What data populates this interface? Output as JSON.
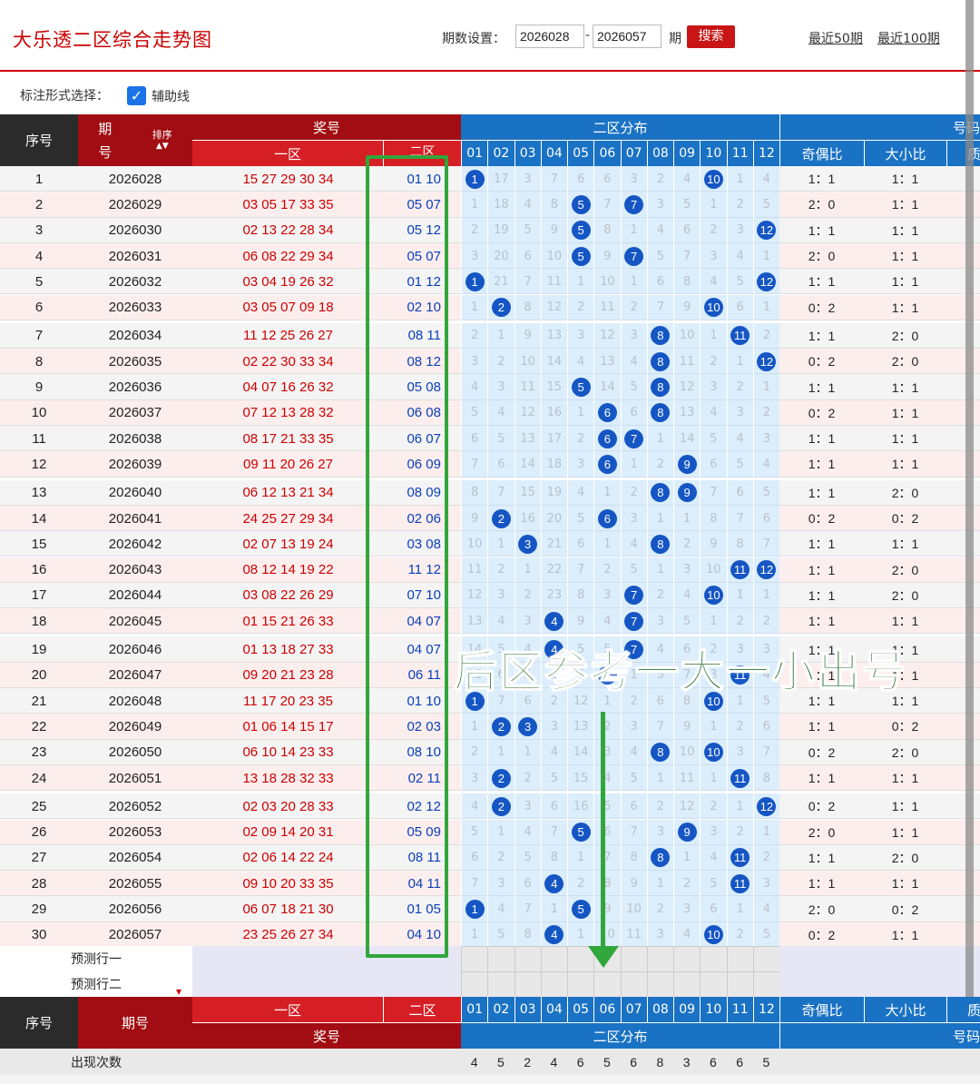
{
  "header": {
    "title": "大乐透二区综合走势图",
    "period_label": "期数设置：",
    "from": "2026028",
    "to": "2026057",
    "dash": "-",
    "qi": "期",
    "search": "搜索",
    "recent50": "最近50期",
    "recent100": "最近100期"
  },
  "options": {
    "label": "标注形式选择：",
    "checkbox_label": "辅助线"
  },
  "table": {
    "h_seq": "序号",
    "h_issue1": "期",
    "h_issue2": "号",
    "h_sort": "排序",
    "h_award": "奖号",
    "h_zone1": "一区",
    "h_zone2": "二区",
    "h_dist": "二区分布",
    "h_hao": "号码",
    "h_odd": "奇偶比",
    "h_big": "大小比",
    "h_prime": "质",
    "cols": [
      "01",
      "02",
      "03",
      "04",
      "05",
      "06",
      "07",
      "08",
      "09",
      "10",
      "11",
      "12"
    ],
    "rows": [
      {
        "n": "1",
        "issue": "2026028",
        "front": "15 27 29 30 34",
        "back": "01 10",
        "dist": [
          "1",
          "17",
          "3",
          "7",
          "6",
          "6",
          "3",
          "2",
          "4",
          "10",
          "1",
          "4"
        ],
        "odd": "1：1",
        "big": "1：1"
      },
      {
        "n": "2",
        "issue": "2026029",
        "front": "03 05 17 33 35",
        "back": "05 07",
        "dist": [
          "1",
          "18",
          "4",
          "8",
          "5",
          "7",
          "7",
          "3",
          "5",
          "1",
          "2",
          "5"
        ],
        "odd": "2：0",
        "big": "1：1"
      },
      {
        "n": "3",
        "issue": "2026030",
        "front": "02 13 22 28 34",
        "back": "05 12",
        "dist": [
          "2",
          "19",
          "5",
          "9",
          "5",
          "8",
          "1",
          "4",
          "6",
          "2",
          "3",
          "12"
        ],
        "odd": "1：1",
        "big": "1：1"
      },
      {
        "n": "4",
        "issue": "2026031",
        "front": "06 08 22 29 34",
        "back": "05 07",
        "dist": [
          "3",
          "20",
          "6",
          "10",
          "5",
          "9",
          "7",
          "5",
          "7",
          "3",
          "4",
          "1"
        ],
        "odd": "2：0",
        "big": "1：1"
      },
      {
        "n": "5",
        "issue": "2026032",
        "front": "03 04 19 26 32",
        "back": "01 12",
        "dist": [
          "1",
          "21",
          "7",
          "11",
          "1",
          "10",
          "1",
          "6",
          "8",
          "4",
          "5",
          "12"
        ],
        "odd": "1：1",
        "big": "1：1"
      },
      {
        "n": "6",
        "issue": "2026033",
        "front": "03 05 07 09 18",
        "back": "02 10",
        "dist": [
          "1",
          "2",
          "8",
          "12",
          "2",
          "11",
          "2",
          "7",
          "9",
          "10",
          "6",
          "1"
        ],
        "odd": "0：2",
        "big": "1：1"
      },
      {
        "n": "7",
        "issue": "2026034",
        "front": "11 12 25 26 27",
        "back": "08 11",
        "dist": [
          "2",
          "1",
          "9",
          "13",
          "3",
          "12",
          "3",
          "8",
          "10",
          "1",
          "11",
          "2"
        ],
        "odd": "1：1",
        "big": "2：0"
      },
      {
        "n": "8",
        "issue": "2026035",
        "front": "02 22 30 33 34",
        "back": "08 12",
        "dist": [
          "3",
          "2",
          "10",
          "14",
          "4",
          "13",
          "4",
          "8",
          "11",
          "2",
          "1",
          "12"
        ],
        "odd": "0：2",
        "big": "2：0"
      },
      {
        "n": "9",
        "issue": "2026036",
        "front": "04 07 16 26 32",
        "back": "05 08",
        "dist": [
          "4",
          "3",
          "11",
          "15",
          "5",
          "14",
          "5",
          "8",
          "12",
          "3",
          "2",
          "1"
        ],
        "odd": "1：1",
        "big": "1：1"
      },
      {
        "n": "10",
        "issue": "2026037",
        "front": "07 12 13 28 32",
        "back": "06 08",
        "dist": [
          "5",
          "4",
          "12",
          "16",
          "1",
          "6",
          "6",
          "8",
          "13",
          "4",
          "3",
          "2"
        ],
        "odd": "0：2",
        "big": "1：1"
      },
      {
        "n": "11",
        "issue": "2026038",
        "front": "08 17 21 33 35",
        "back": "06 07",
        "dist": [
          "6",
          "5",
          "13",
          "17",
          "2",
          "6",
          "7",
          "1",
          "14",
          "5",
          "4",
          "3"
        ],
        "odd": "1：1",
        "big": "1：1"
      },
      {
        "n": "12",
        "issue": "2026039",
        "front": "09 11 20 26 27",
        "back": "06 09",
        "dist": [
          "7",
          "6",
          "14",
          "18",
          "3",
          "6",
          "1",
          "2",
          "9",
          "6",
          "5",
          "4"
        ],
        "odd": "1：1",
        "big": "1：1"
      },
      {
        "n": "13",
        "issue": "2026040",
        "front": "06 12 13 21 34",
        "back": "08 09",
        "dist": [
          "8",
          "7",
          "15",
          "19",
          "4",
          "1",
          "2",
          "8",
          "9",
          "7",
          "6",
          "5"
        ],
        "odd": "1：1",
        "big": "2：0"
      },
      {
        "n": "14",
        "issue": "2026041",
        "front": "24 25 27 29 34",
        "back": "02 06",
        "dist": [
          "9",
          "2",
          "16",
          "20",
          "5",
          "6",
          "3",
          "1",
          "1",
          "8",
          "7",
          "6"
        ],
        "odd": "0：2",
        "big": "0：2"
      },
      {
        "n": "15",
        "issue": "2026042",
        "front": "02 07 13 19 24",
        "back": "03 08",
        "dist": [
          "10",
          "1",
          "3",
          "21",
          "6",
          "1",
          "4",
          "8",
          "2",
          "9",
          "8",
          "7"
        ],
        "odd": "1：1",
        "big": "1：1"
      },
      {
        "n": "16",
        "issue": "2026043",
        "front": "08 12 14 19 22",
        "back": "11 12",
        "dist": [
          "11",
          "2",
          "1",
          "22",
          "7",
          "2",
          "5",
          "1",
          "3",
          "10",
          "11",
          "12"
        ],
        "odd": "1：1",
        "big": "2：0"
      },
      {
        "n": "17",
        "issue": "2026044",
        "front": "03 08 22 26 29",
        "back": "07 10",
        "dist": [
          "12",
          "3",
          "2",
          "23",
          "8",
          "3",
          "7",
          "2",
          "4",
          "10",
          "1",
          "1"
        ],
        "odd": "1：1",
        "big": "2：0"
      },
      {
        "n": "18",
        "issue": "2026045",
        "front": "01 15 21 26 33",
        "back": "04 07",
        "dist": [
          "13",
          "4",
          "3",
          "4",
          "9",
          "4",
          "7",
          "3",
          "5",
          "1",
          "2",
          "2"
        ],
        "odd": "1：1",
        "big": "1：1"
      },
      {
        "n": "19",
        "issue": "2026046",
        "front": "01 13 18 27 33",
        "back": "04 07",
        "dist": [
          "14",
          "5",
          "4",
          "4",
          "5",
          "5",
          "7",
          "4",
          "6",
          "2",
          "3",
          "3"
        ],
        "odd": "1：1",
        "big": "1：1"
      },
      {
        "n": "20",
        "issue": "2026047",
        "front": "09 20 21 23 28",
        "back": "06 11",
        "dist": [
          "15",
          "6",
          "5",
          "1",
          "6",
          "6",
          "1",
          "5",
          "7",
          "3",
          "11",
          "4"
        ],
        "odd": "1：1",
        "big": "1：1"
      },
      {
        "n": "21",
        "issue": "2026048",
        "front": "11 17 20 23 35",
        "back": "01 10",
        "dist": [
          "1",
          "7",
          "6",
          "2",
          "12",
          "1",
          "2",
          "6",
          "8",
          "10",
          "1",
          "5"
        ],
        "odd": "1：1",
        "big": "1：1"
      },
      {
        "n": "22",
        "issue": "2026049",
        "front": "01 06 14 15 17",
        "back": "02 03",
        "dist": [
          "1",
          "2",
          "3",
          "3",
          "13",
          "2",
          "3",
          "7",
          "9",
          "1",
          "2",
          "6"
        ],
        "odd": "1：1",
        "big": "0：2"
      },
      {
        "n": "23",
        "issue": "2026050",
        "front": "06 10 14 23 33",
        "back": "08 10",
        "dist": [
          "2",
          "1",
          "1",
          "4",
          "14",
          "3",
          "4",
          "8",
          "10",
          "10",
          "3",
          "7"
        ],
        "odd": "0：2",
        "big": "2：0"
      },
      {
        "n": "24",
        "issue": "2026051",
        "front": "13 18 28 32 33",
        "back": "02 11",
        "dist": [
          "3",
          "2",
          "2",
          "5",
          "15",
          "4",
          "5",
          "1",
          "11",
          "1",
          "11",
          "8"
        ],
        "odd": "1：1",
        "big": "1：1"
      },
      {
        "n": "25",
        "issue": "2026052",
        "front": "02 03 20 28 33",
        "back": "02 12",
        "dist": [
          "4",
          "2",
          "3",
          "6",
          "16",
          "5",
          "6",
          "2",
          "12",
          "2",
          "1",
          "12"
        ],
        "odd": "0：2",
        "big": "1：1"
      },
      {
        "n": "26",
        "issue": "2026053",
        "front": "02 09 14 20 31",
        "back": "05 09",
        "dist": [
          "5",
          "1",
          "4",
          "7",
          "5",
          "6",
          "7",
          "3",
          "9",
          "3",
          "2",
          "1"
        ],
        "odd": "2：0",
        "big": "1：1"
      },
      {
        "n": "27",
        "issue": "2026054",
        "front": "02 06 14 22 24",
        "back": "08 11",
        "dist": [
          "6",
          "2",
          "5",
          "8",
          "1",
          "7",
          "8",
          "8",
          "1",
          "4",
          "11",
          "2"
        ],
        "odd": "1：1",
        "big": "2：0"
      },
      {
        "n": "28",
        "issue": "2026055",
        "front": "09 10 20 33 35",
        "back": "04 11",
        "dist": [
          "7",
          "3",
          "6",
          "4",
          "2",
          "8",
          "9",
          "1",
          "2",
          "5",
          "11",
          "3"
        ],
        "odd": "1：1",
        "big": "1：1"
      },
      {
        "n": "29",
        "issue": "2026056",
        "front": "06 07 18 21 30",
        "back": "01 05",
        "dist": [
          "1",
          "4",
          "7",
          "1",
          "5",
          "9",
          "10",
          "2",
          "3",
          "6",
          "1",
          "4"
        ],
        "odd": "2：0",
        "big": "0：2"
      },
      {
        "n": "30",
        "issue": "2026057",
        "front": "23 25 26 27 34",
        "back": "04 10",
        "dist": [
          "1",
          "5",
          "8",
          "4",
          "1",
          "10",
          "11",
          "3",
          "4",
          "10",
          "2",
          "5"
        ],
        "odd": "0：2",
        "big": "1：1"
      }
    ],
    "hits": [
      [
        "01",
        "10"
      ],
      [
        "05",
        "07"
      ],
      [
        "05",
        "12"
      ],
      [
        "05",
        "07"
      ],
      [
        "01",
        "12"
      ],
      [
        "02",
        "10"
      ],
      [
        "08",
        "11"
      ],
      [
        "08",
        "12"
      ],
      [
        "05",
        "08"
      ],
      [
        "06",
        "08"
      ],
      [
        "06",
        "07"
      ],
      [
        "06",
        "09"
      ],
      [
        "08",
        "09"
      ],
      [
        "02",
        "06"
      ],
      [
        "03",
        "08"
      ],
      [
        "11",
        "12"
      ],
      [
        "07",
        "10"
      ],
      [
        "04",
        "07"
      ],
      [
        "04",
        "07"
      ],
      [
        "06",
        "11"
      ],
      [
        "01",
        "10"
      ],
      [
        "02",
        "03"
      ],
      [
        "08",
        "10"
      ],
      [
        "02",
        "11"
      ],
      [
        "02",
        "12"
      ],
      [
        "05",
        "09"
      ],
      [
        "08",
        "11"
      ],
      [
        "04",
        "11"
      ],
      [
        "01",
        "05"
      ],
      [
        "04",
        "10"
      ]
    ],
    "pred1": "预测行一",
    "pred2": "预测行二",
    "foot_seq": "序号",
    "foot_issue": "期号",
    "foot_z1": "一区",
    "foot_z2": "二区",
    "foot_award": "奖号",
    "foot_dist": "二区分布",
    "foot_odd": "奇偶比",
    "foot_big": "大小比",
    "foot_prime": "质",
    "foot_hao": "号码",
    "occ_label": "出现次数",
    "occ": [
      "4",
      "5",
      "2",
      "4",
      "6",
      "5",
      "6",
      "8",
      "3",
      "6",
      "6",
      "5"
    ]
  },
  "annotation": {
    "text": "后区参考一大一小出号",
    "color": "#31a63b"
  }
}
